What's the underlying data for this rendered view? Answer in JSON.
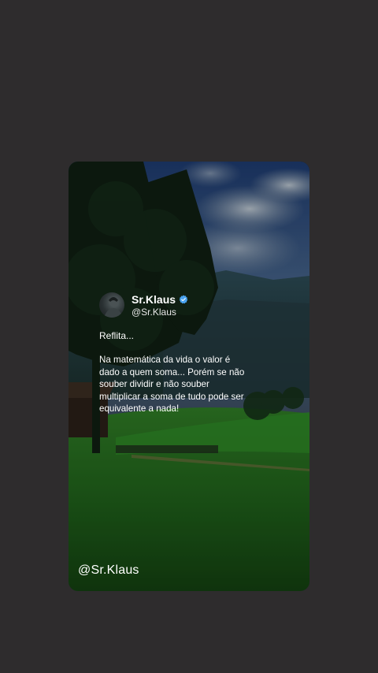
{
  "post": {
    "display_name": "Sr.Klaus",
    "handle": "@Sr.Klaus",
    "verified_icon": "verified-badge-icon",
    "verified_color": "#4aa3f0",
    "intro": "Reflita...",
    "body": "Na matemática da vida o valor é dado a quem soma... Porém se não souber dividir e não souber multiplicar a soma de tudo pode ser equivalente a nada!"
  },
  "watermark": "@Sr.Klaus",
  "colors": {
    "background": "#2e2c2d",
    "text": "#ffffff"
  }
}
